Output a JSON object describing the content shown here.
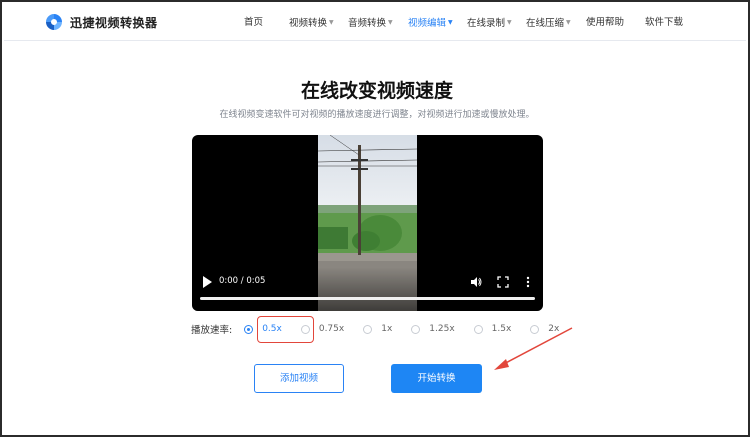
{
  "header": {
    "brand": "迅捷视频转换器",
    "nav": [
      {
        "label": "首页",
        "dropdown": false,
        "active": false
      },
      {
        "label": "视频转换",
        "dropdown": true,
        "active": false
      },
      {
        "label": "音频转换",
        "dropdown": true,
        "active": false
      },
      {
        "label": "视频编辑",
        "dropdown": true,
        "active": true
      },
      {
        "label": "在线录制",
        "dropdown": true,
        "active": false
      },
      {
        "label": "在线压缩",
        "dropdown": true,
        "active": false
      },
      {
        "label": "使用帮助",
        "dropdown": false,
        "active": false
      },
      {
        "label": "软件下载",
        "dropdown": false,
        "active": false
      }
    ]
  },
  "main": {
    "title": "在线改变视频速度",
    "subtitle": "在线视频变速软件可对视频的播放速度进行调整，对视频进行加速或慢放处理。"
  },
  "video": {
    "time": "0:00 / 0:05",
    "progress": 0
  },
  "speed": {
    "label": "播放速率:",
    "options": [
      "0.5x",
      "0.75x",
      "1x",
      "1.25x",
      "1.5x",
      "2x"
    ],
    "selected": "0.5x"
  },
  "buttons": {
    "add": "添加视频",
    "start": "开始转换"
  },
  "colors": {
    "accent": "#2a83f5",
    "highlight": "#e2463b"
  }
}
